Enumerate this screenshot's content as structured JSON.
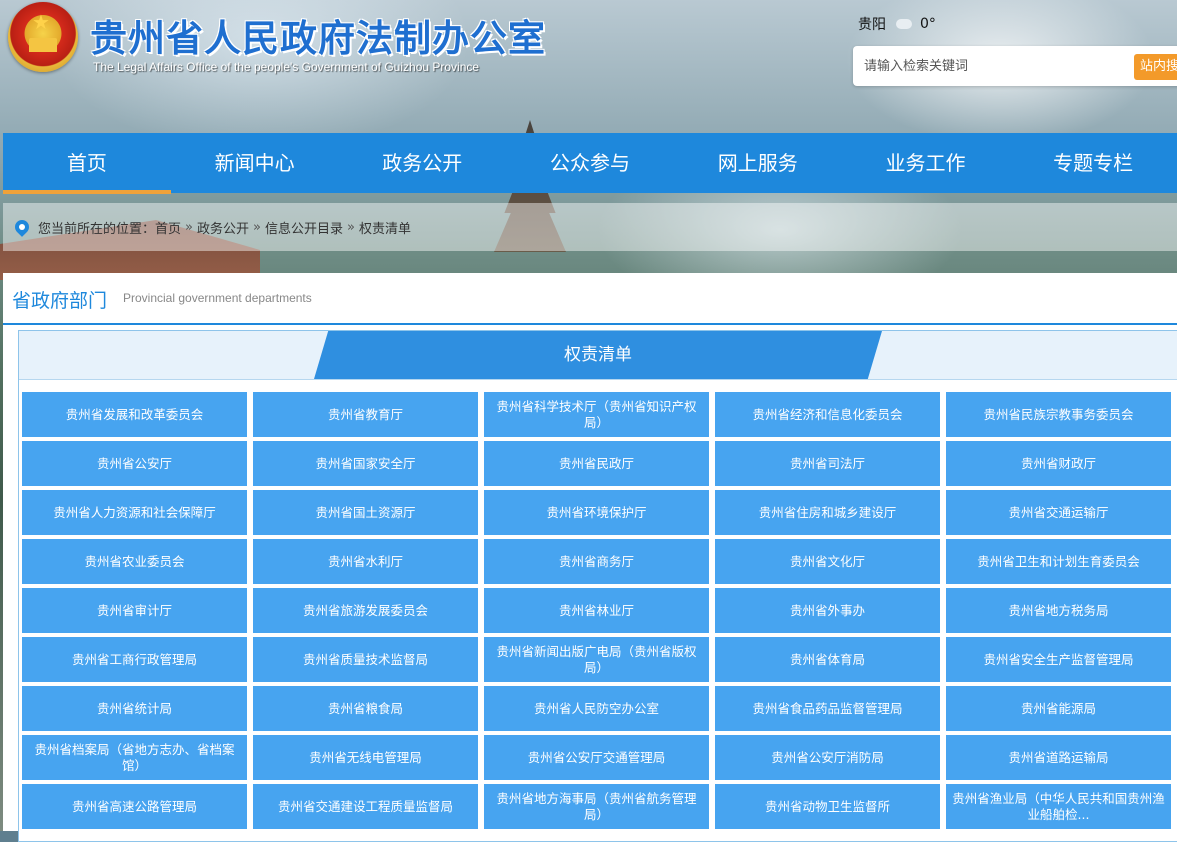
{
  "header": {
    "title": "贵州省人民政府法制办公室",
    "subtitle": "The Legal Affairs Office of the people's Government of Guizhou Province",
    "weather": {
      "city": "贵阳",
      "temperature": "0°"
    },
    "search": {
      "placeholder": "请输入检索关键词",
      "button_label": "站内搜索"
    }
  },
  "nav": {
    "items": [
      {
        "label": "首页",
        "active": true
      },
      {
        "label": "新闻中心"
      },
      {
        "label": "政务公开"
      },
      {
        "label": "公众参与"
      },
      {
        "label": "网上服务"
      },
      {
        "label": "业务工作"
      },
      {
        "label": "专题专栏"
      }
    ]
  },
  "breadcrumb": {
    "prefix": "您当前所在的位置：",
    "items": [
      "首页",
      "政务公开",
      "信息公开目录",
      "权责清单"
    ],
    "separator": "»"
  },
  "section": {
    "title": "省政府部门",
    "subtitle_en": "Provincial government departments"
  },
  "list": {
    "tab_title": "权责清单",
    "departments": [
      "贵州省发展和改革委员会",
      "贵州省教育厅",
      "贵州省科学技术厅（贵州省知识产权局）",
      "贵州省经济和信息化委员会",
      "贵州省民族宗教事务委员会",
      "贵州省公安厅",
      "贵州省国家安全厅",
      "贵州省民政厅",
      "贵州省司法厅",
      "贵州省财政厅",
      "贵州省人力资源和社会保障厅",
      "贵州省国土资源厅",
      "贵州省环境保护厅",
      "贵州省住房和城乡建设厅",
      "贵州省交通运输厅",
      "贵州省农业委员会",
      "贵州省水利厅",
      "贵州省商务厅",
      "贵州省文化厅",
      "贵州省卫生和计划生育委员会",
      "贵州省审计厅",
      "贵州省旅游发展委员会",
      "贵州省林业厅",
      "贵州省外事办",
      "贵州省地方税务局",
      "贵州省工商行政管理局",
      "贵州省质量技术监督局",
      "贵州省新闻出版广电局（贵州省版权局）",
      "贵州省体育局",
      "贵州省安全生产监督管理局",
      "贵州省统计局",
      "贵州省粮食局",
      "贵州省人民防空办公室",
      "贵州省食品药品监督管理局",
      "贵州省能源局",
      "贵州省档案局（省地方志办、省档案馆）",
      "贵州省无线电管理局",
      "贵州省公安厅交通管理局",
      "贵州省公安厅消防局",
      "贵州省道路运输局",
      "贵州省高速公路管理局",
      "贵州省交通建设工程质量监督局",
      "贵州省地方海事局（贵州省航务管理局）",
      "贵州省动物卫生监督所",
      "贵州省渔业局（中华人民共和国贵州渔业船舶检..."
    ]
  },
  "colors": {
    "nav_bg": "#1e88dc",
    "nav_active_underline": "#f0a23a",
    "dept_button": "#47a4f0",
    "title_blue": "#1f6fd0",
    "search_button": "#f39a2a"
  }
}
